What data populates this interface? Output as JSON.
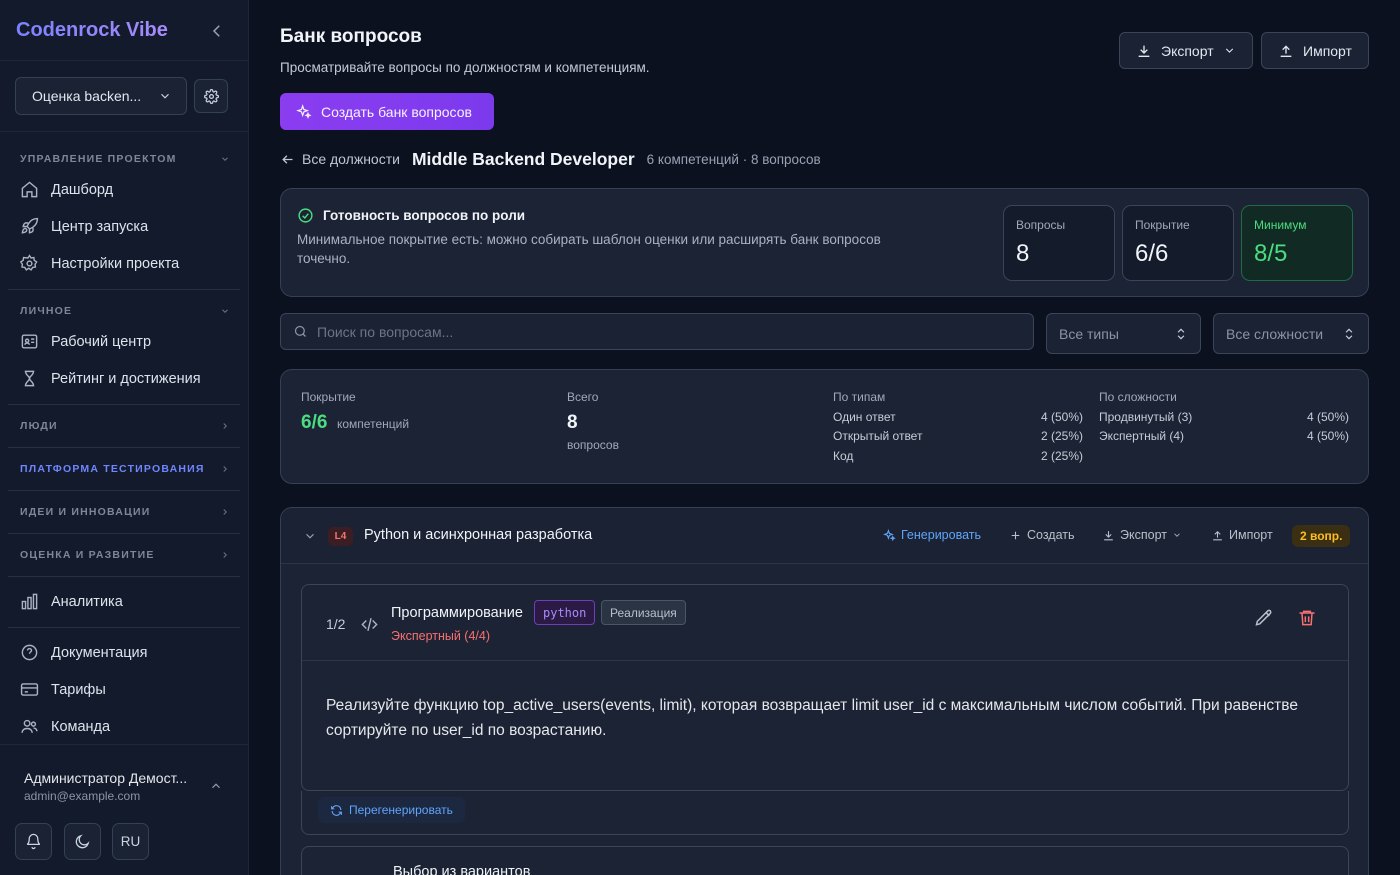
{
  "sidebar": {
    "brand": "Codenrock Vibe",
    "project_select": "Оценка backen...",
    "sections": {
      "project_mgmt": "УПРАВЛЕНИЕ ПРОЕКТОМ",
      "personal": "ЛИЧНОЕ",
      "people": "ЛЮДИ",
      "testing": "ПЛАТФОРМА ТЕСТИРОВАНИЯ",
      "ideas": "ИДЕИ И ИННОВАЦИИ",
      "evaluation": "ОЦЕНКА И РАЗВИТИЕ"
    },
    "items": {
      "dashboard": "Дашборд",
      "launch": "Центр запуска",
      "project_settings": "Настройки проекта",
      "workspace": "Рабочий центр",
      "rating": "Рейтинг и достижения",
      "analytics": "Аналитика",
      "docs": "Документация",
      "pricing": "Тарифы",
      "team": "Команда"
    },
    "user": {
      "name": "Администратор Демост...",
      "email": "admin@example.com"
    },
    "lang": "RU"
  },
  "header": {
    "title": "Банк вопросов",
    "subtitle": "Просматривайте вопросы по должностям и компетенциям.",
    "export_label": "Экспорт",
    "import_label": "Импорт",
    "create_bank_label": "Создать банк вопросов"
  },
  "breadcrumb": {
    "back_label": "Все должности",
    "role": "Middle Backend Developer",
    "meta": "6 компетенций · 8 вопросов"
  },
  "readiness": {
    "title": "Готовность вопросов по роли",
    "description": "Минимальное покрытие есть: можно собирать шаблон оценки или расширять банк вопросов точечно.",
    "stats": [
      {
        "label": "Вопросы",
        "value": "8"
      },
      {
        "label": "Покрытие",
        "value": "6/6"
      },
      {
        "label": "Минимум",
        "value": "8/5"
      }
    ]
  },
  "filters": {
    "search_placeholder": "Поиск по вопросам...",
    "type_select": "Все типы",
    "difficulty_select": "Все сложности"
  },
  "summary": {
    "coverage_label": "Покрытие",
    "coverage_value": "6/6",
    "coverage_unit": "компетенций",
    "total_label": "Всего",
    "total_value": "8",
    "total_unit": "вопросов",
    "by_type_label": "По типам",
    "by_type": [
      {
        "name": "Один ответ",
        "value": "4 (50%)"
      },
      {
        "name": "Открытый ответ",
        "value": "2 (25%)"
      },
      {
        "name": "Код",
        "value": "2 (25%)"
      }
    ],
    "by_difficulty_label": "По сложности",
    "by_difficulty": [
      {
        "name": "Продвинутый (3)",
        "value": "4 (50%)"
      },
      {
        "name": "Экспертный (4)",
        "value": "4 (50%)"
      }
    ]
  },
  "competency": {
    "level": "L4",
    "title": "Python и асинхронная разработка",
    "actions": {
      "generate": "Генерировать",
      "create": "Создать",
      "export": "Экспорт",
      "import": "Импорт"
    },
    "count": "2 вопр.",
    "question": {
      "index": "1/2",
      "type": "Программирование",
      "tag_lang": "python",
      "tag_kind": "Реализация",
      "difficulty": "Экспертный (4/4)",
      "text": "Реализуйте функцию top_active_users(events, limit), которая возвращает limit user_id с максимальным числом событий. При равенстве сортируйте по user_id по возрастанию.",
      "regenerate": "Перегенерировать"
    },
    "question2": {
      "type": "Выбор из вариантов"
    }
  },
  "colors": {
    "accent": "#7c3aed",
    "success": "#4ade80",
    "danger": "#f87171",
    "link": "#60a5fa",
    "warning": "#fbbf24"
  }
}
